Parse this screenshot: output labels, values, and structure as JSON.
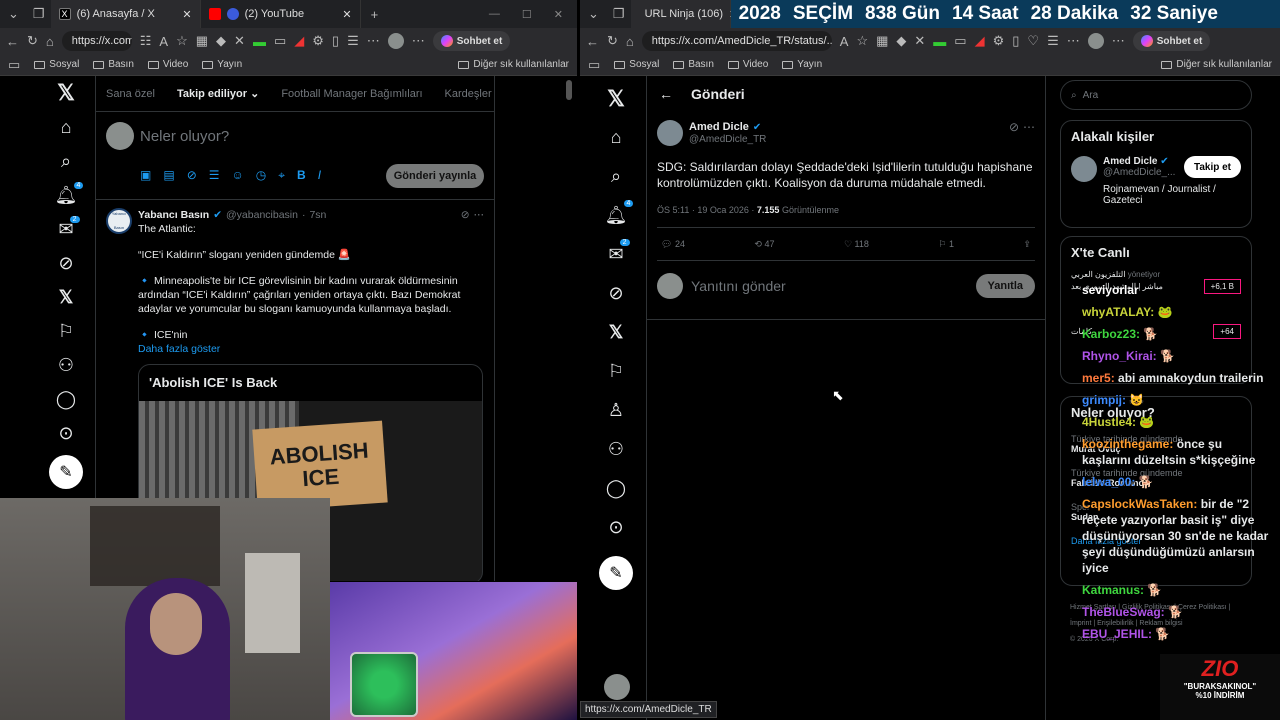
{
  "left_window": {
    "tabs": [
      {
        "label": "(6) Anasayfa / X"
      },
      {
        "label": "(2) YouTube"
      }
    ],
    "url": "https://x.com...",
    "bookmarks": [
      "Sosyal",
      "Basın",
      "Video",
      "Yayın"
    ],
    "bookmarks_other": "Diğer sık kullanılanlar",
    "copilot": "Sohbet et",
    "feed_tabs": [
      "Sana özel",
      "Takip ediliyor",
      "Football Manager Bağımlıları",
      "Kardeşler Kıra"
    ],
    "compose_placeholder": "Neler oluyor?",
    "post_button": "Gönderi yayınla",
    "nav_badges": {
      "notifications": "4",
      "messages": "2"
    },
    "tweet": {
      "author": "Yabancı Basın",
      "handle": "@yabancibasin",
      "time": "7sn",
      "avatar_text": "Yabancı Basın",
      "line1": "The Atlantic:",
      "line2": "“ICE'i Kaldırın” sloganı yeniden gündemde 🚨",
      "line3": "🔹 Minneapolis'te bir ICE görevlisinin bir kadını vurarak öldürmesinin ardından “ICE'i Kaldırın” çağrıları yeniden ortaya çıktı. Bazı Demokrat adaylar ve yorumcular bu sloganı kamuoyunda kullanmaya başladı.",
      "line4": "🔹 ICE'nin",
      "more": "Daha fazla göster",
      "card_title": "'Abolish ICE' Is Back",
      "sign_text": "ABOLISH ICE"
    }
  },
  "right_window": {
    "tabs": [
      {
        "label": "URL Ninja (106)"
      }
    ],
    "countdown": {
      "year": "2028",
      "label": "SEÇİM",
      "days": "838 Gün",
      "hours": "14 Saat",
      "minutes": "28 Dakika",
      "seconds": "32 Saniye"
    },
    "url": "https://x.com/AmedDicle_TR/status/...",
    "bookmarks": [
      "Sosyal",
      "Basın",
      "Video",
      "Yayın"
    ],
    "bookmarks_other": "Diğer sık kullanılanlar",
    "copilot": "Sohbet et",
    "post_header": "Gönderi",
    "nav_badges": {
      "notifications": "4",
      "messages": "2"
    },
    "tweet": {
      "author": "Amed Dicle",
      "handle": "@AmedDicle_TR",
      "text": "SDG: Saldırılardan dolayı Şeddade'deki Işid'lilerin tutulduğu hapishane kontrolümüzden çıktı. Koalisyon da duruma müdahale etmedi.",
      "meta_time": "ÖS 5:11 · 19 Oca 2026 · ",
      "views": "7.155",
      "views_label": "Görüntülenme",
      "replies": "24",
      "retweets": "47",
      "likes": "118",
      "bookmarks": "1"
    },
    "reply_placeholder": "Yanıtını gönder",
    "reply_button": "Yanıtla",
    "search_placeholder": "Ara",
    "related_title": "Alakalı kişiler",
    "related": {
      "name": "Amed Dicle",
      "handle": "@AmedDicle_...",
      "bio": "Rojnamevan / Journalist / Gazeteci",
      "follow": "Takip et"
    },
    "live_title": "X'te Canlı",
    "live_items": [
      {
        "name": "التلفزيون العربي",
        "tail": "yönetiyor",
        "title": "مباشر | المشهد السوري بعد",
        "count": "+6,1 B"
      },
      {
        "name": "",
        "tail": "",
        "title": "كلمات",
        "count": "+64"
      }
    ],
    "trends_title": "Neler oluyor?",
    "trends": [
      {
        "context": "Türkiye tarihinde gündemde",
        "name": "Murat Övüç"
      },
      {
        "context": "Türkiye tarihinde gündemde",
        "name": "Fabrizio Romano"
      },
      {
        "context": "Spor",
        "name": "Sudan"
      }
    ],
    "trends_more": "Daha fazla göster",
    "footer": [
      "Hizmet Şartları",
      "Gizlilik Politikası",
      "Çerez Politikası",
      "İmprint",
      "Erişilebilirlik",
      "Reklam bilgisi",
      "© 2026 X Corp."
    ],
    "status_url": "https://x.com/AmedDicle_TR"
  },
  "chat": [
    {
      "user": "seviyorlar",
      "msg": ""
    },
    {
      "user": "whyATALAY:",
      "msg": "🐸"
    },
    {
      "user": "Karboz23:",
      "msg": "🐕"
    },
    {
      "user": "Rhyno_Kirai:",
      "msg": "🐕"
    },
    {
      "user": "mer5:",
      "msg": "abi amınakoydun trailerin"
    },
    {
      "user": "grimpij:",
      "msg": "😺"
    },
    {
      "user": "4Hustle4:",
      "msg": "🐸"
    },
    {
      "user": "koozinthegame:",
      "msg": "önce şu kaşlarını düzeltsin s*kişçeğine"
    },
    {
      "user": "lelwa_00:",
      "msg": "🐕"
    },
    {
      "user": "CapslockWasTaken:",
      "msg": "bir de \"2 reçete yazıyorlar basit iş\" diye düşünüyorsan 30 sn'de ne kadar şeyi düşündüğümüzü anlarsın iyice"
    },
    {
      "user": "Katmanus:",
      "msg": "🐕"
    },
    {
      "user": "TheBlueSwag:",
      "msg": "🐕"
    },
    {
      "user": "EBU_JEHIL:",
      "msg": "🐕"
    }
  ],
  "overlay": {
    "logo": "ZIO",
    "promo_line1": "\"BURAKSAKINOL\"",
    "promo_line2": "%10 İNDİRİM"
  }
}
